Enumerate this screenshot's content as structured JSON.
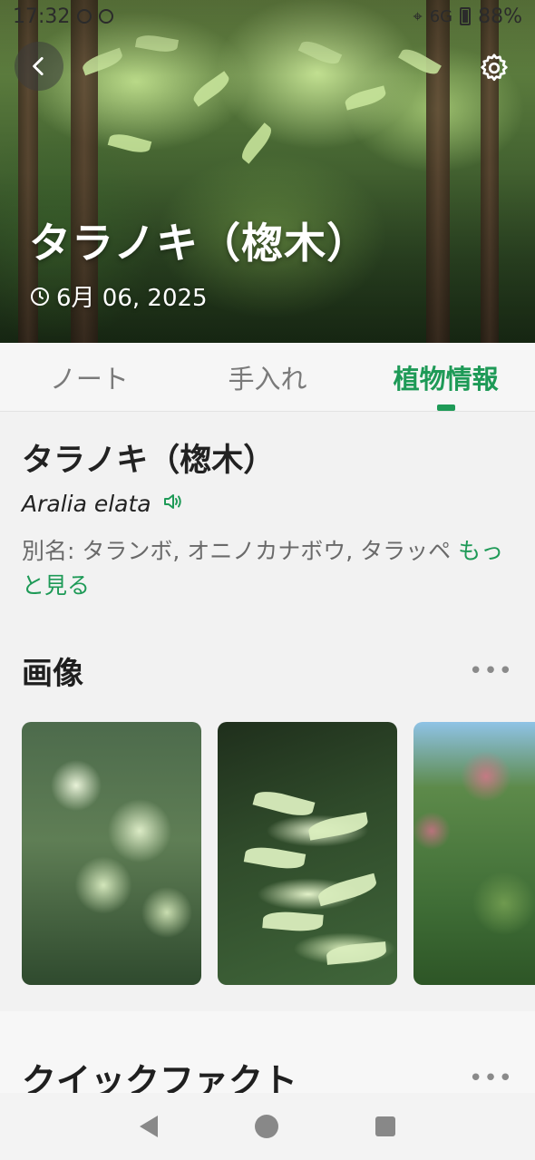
{
  "status_bar": {
    "time": "17:32",
    "network": "6G",
    "battery": "88%"
  },
  "hero": {
    "title": "タラノキ（楤木）",
    "date": "6月 06, 2025"
  },
  "tabs": [
    {
      "label": "ノート",
      "active": false
    },
    {
      "label": "手入れ",
      "active": false
    },
    {
      "label": "植物情報",
      "active": true
    }
  ],
  "plant": {
    "name": "タラノキ（楤木）",
    "scientific_name": "Aralia elata",
    "aliases": "別名: タランボ, オニノカナボウ, タラッペ",
    "more_label": "もっと見る"
  },
  "images_section": {
    "title": "画像",
    "more": "•••"
  },
  "facts_section": {
    "title": "クイックファクト",
    "more": "•••"
  },
  "colors": {
    "accent": "#1e9a57",
    "background": "#f2f2f2"
  }
}
